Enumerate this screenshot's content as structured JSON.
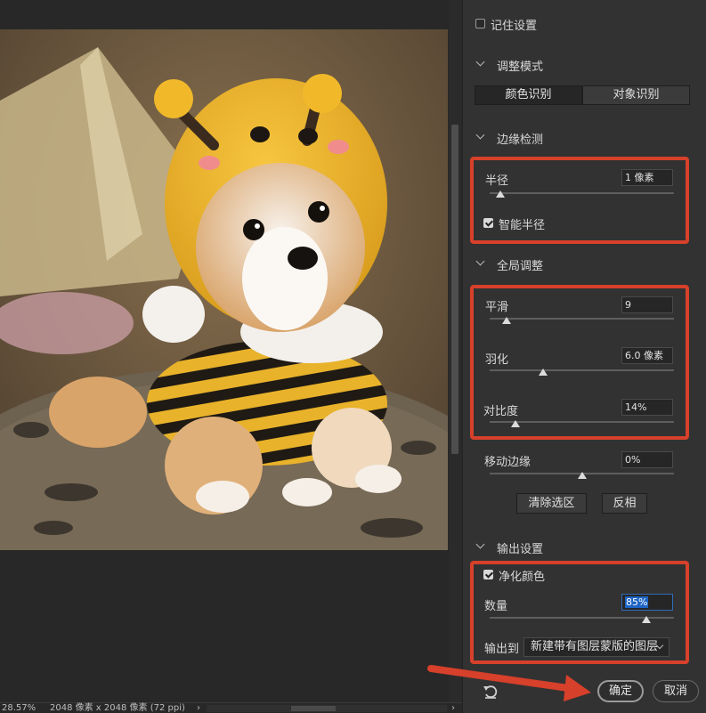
{
  "colors": {
    "accent": "#d7402a",
    "focus": "#1d64c4",
    "panel": "#323232"
  },
  "panel": {
    "remember_settings": {
      "label": "记住设置",
      "checked": false
    },
    "adjust_mode": {
      "title": "调整模式",
      "options": [
        "颜色识别",
        "对象识别"
      ],
      "selected": "颜色识别"
    },
    "edge_detection": {
      "title": "边缘检测",
      "radius": {
        "label": "半径",
        "value": "1 像素",
        "level": 0.06
      },
      "smart_radius": {
        "label": "智能半径",
        "checked": true
      }
    },
    "global_adjust": {
      "title": "全局调整",
      "smooth": {
        "label": "平滑",
        "value": "9",
        "level": 0.09
      },
      "feather": {
        "label": "羽化",
        "value": "6.0 像素",
        "level": 0.29
      },
      "contrast": {
        "label": "对比度",
        "value": "14%",
        "level": 0.14
      },
      "shift_edge": {
        "label": "移动边缘",
        "value": "0%",
        "level": 0.5
      },
      "clear_selection_label": "清除选区",
      "invert_label": "反相"
    },
    "output": {
      "title": "输出设置",
      "decontaminate": {
        "label": "净化颜色",
        "checked": true
      },
      "amount": {
        "label": "数量",
        "value": "85%",
        "level": 0.85
      },
      "output_to": {
        "label": "输出到",
        "value": "新建带有图层蒙版的图层"
      }
    },
    "footer": {
      "reset_icon": "reset-icon",
      "ok_label": "确定",
      "cancel_label": "取消"
    }
  },
  "status": {
    "zoom": "28.57%",
    "dimensions": "2048 像素 x 2048 像素 (72 ppi)",
    "nav_arrow": "›"
  }
}
